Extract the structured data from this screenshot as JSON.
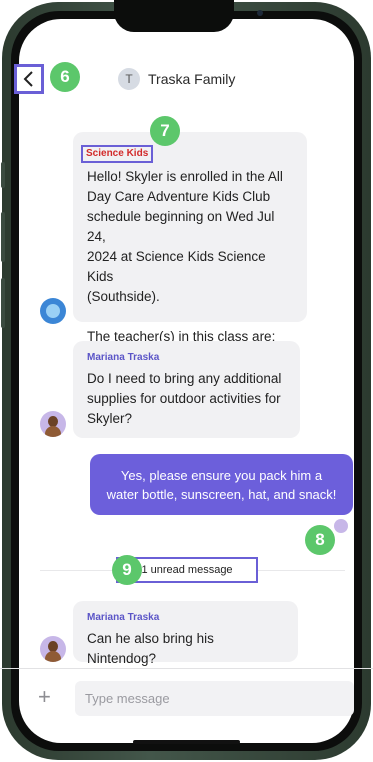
{
  "header": {
    "title": "Traska Family",
    "avatar_letter": "T"
  },
  "badges": {
    "back": "6",
    "sender": "7",
    "avatar": "8",
    "unread": "9"
  },
  "messages": [
    {
      "sender": "Science Kids",
      "text": "Hello! Skyler is enrolled in the All\nDay Care Adventure Kids Club\nschedule beginning on Wed Jul 24,\n2024 at Science Kids Science Kids\n(Southside).\n\nThe teacher(s) in this class are:\nSarah, Andre."
    },
    {
      "sender": "Mariana Traska",
      "text": "Do I need to bring any additional\nsupplies for outdoor activities for\nSkyler?"
    },
    {
      "text": "Yes, please ensure you pack him a\nwater bottle, sunscreen, hat, and snack!"
    },
    {
      "sender": "Mariana Traska",
      "text": "Can he also bring his Nintendog?"
    }
  ],
  "unread_label": "1 unread message",
  "composer": {
    "placeholder": "Type message",
    "add_icon": "plus-icon"
  },
  "colors": {
    "accent": "#6c5fdb",
    "badge": "#5cc76b",
    "sender_red": "#d22a2a",
    "sender_blue": "#5b55c7"
  }
}
